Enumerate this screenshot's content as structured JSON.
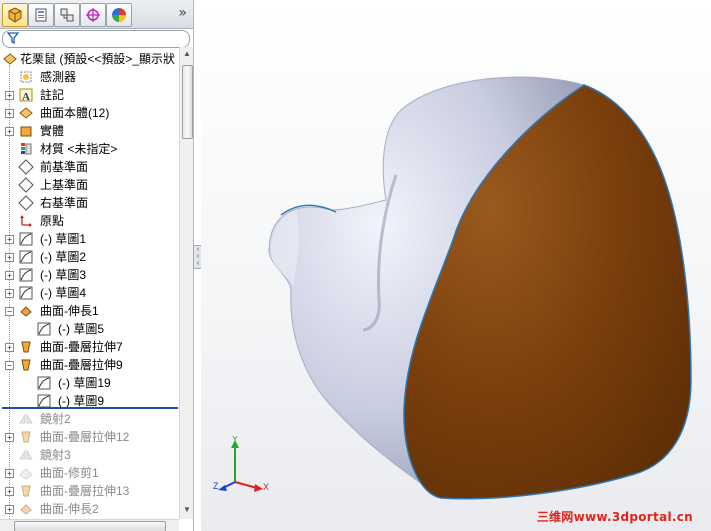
{
  "tabs": [
    {
      "icon": "feature-manager-icon"
    },
    {
      "icon": "property-manager-icon"
    },
    {
      "icon": "configuration-manager-icon"
    },
    {
      "icon": "dimxpert-manager-icon"
    },
    {
      "icon": "display-manager-icon"
    }
  ],
  "tabs_more": "»",
  "filter": {
    "icon": "filter-icon"
  },
  "tree": {
    "root": "花栗鼠 (預設<<預設>_顯示狀",
    "items": [
      {
        "label": "感測器",
        "icon": "sensor-icon"
      },
      {
        "label": "註記",
        "icon": "annotation-icon"
      },
      {
        "label": "曲面本體(12)",
        "icon": "surface-bodies-icon"
      },
      {
        "label": "實體",
        "icon": "solid-bodies-icon"
      },
      {
        "label": "材質 <未指定>",
        "icon": "material-icon"
      },
      {
        "label": "前基準面",
        "icon": "plane-icon"
      },
      {
        "label": "上基準面",
        "icon": "plane-icon"
      },
      {
        "label": "右基準面",
        "icon": "plane-icon"
      },
      {
        "label": "原點",
        "icon": "origin-icon"
      },
      {
        "label": "(-) 草圖1",
        "icon": "sketch-icon"
      },
      {
        "label": "(-) 草圖2",
        "icon": "sketch-icon"
      },
      {
        "label": "(-) 草圖3",
        "icon": "sketch-icon"
      },
      {
        "label": "(-) 草圖4",
        "icon": "sketch-icon"
      },
      {
        "label": "曲面-伸長1",
        "icon": "surface-extrude-icon"
      },
      {
        "label": "(-) 草圖5",
        "icon": "sketch-icon"
      },
      {
        "label": "曲面-疊層拉伸7",
        "icon": "surface-loft-icon"
      },
      {
        "label": "曲面-疊層拉伸9",
        "icon": "surface-loft-icon"
      },
      {
        "label": "(-) 草圖19",
        "icon": "sketch-icon"
      },
      {
        "label": "(-) 草圖9",
        "icon": "sketch-icon"
      },
      {
        "label": "鏡射2",
        "icon": "mirror-icon"
      },
      {
        "label": "曲面-疊層拉伸12",
        "icon": "surface-loft-icon"
      },
      {
        "label": "鏡射3",
        "icon": "mirror-icon"
      },
      {
        "label": "曲面-修剪1",
        "icon": "surface-trim-icon"
      },
      {
        "label": "曲面-疊層拉伸13",
        "icon": "surface-loft-icon"
      },
      {
        "label": "曲面-伸長2",
        "icon": "surface-extrude-icon"
      }
    ]
  },
  "triad": {
    "x": "X",
    "y": "Y",
    "z": "Z"
  },
  "watermark": "三维网www.3dportal.cn",
  "colors": {
    "model_body": "#c9cde0",
    "model_face": "#7a3f0c",
    "selection_edge": "#2a78b8",
    "rollback_bar": "#1f4fa8",
    "watermark": "#e1251b"
  }
}
